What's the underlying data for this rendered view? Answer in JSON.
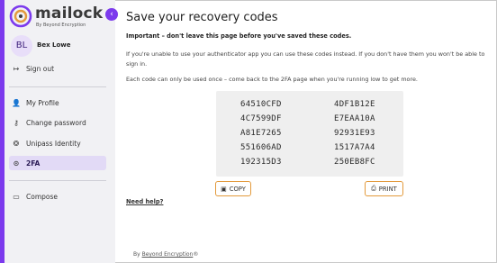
{
  "colors": {
    "accent": "#7c3aed",
    "button_border": "#e39a3c",
    "codes_bg": "#efefef",
    "active_nav_bg": "#e2daf6"
  },
  "logo": {
    "word": "mailock",
    "subtitle": "By Beyond Encryption",
    "icon": "mailock-logo-icon"
  },
  "collapse": {
    "icon": "chevron-left-icon",
    "glyph": "‹"
  },
  "user": {
    "initials": "BL",
    "name": "Bex Lowe"
  },
  "sidebar": {
    "sign_out": {
      "label": "Sign out",
      "icon": "sign-out-icon",
      "glyph": "↦"
    },
    "items": [
      {
        "label": "My Profile",
        "icon": "person-icon",
        "glyph": "👤"
      },
      {
        "label": "Change password",
        "icon": "key-icon",
        "glyph": "⚷"
      },
      {
        "label": "Unipass Identity",
        "icon": "shield-icon",
        "glyph": "❂"
      },
      {
        "label": "2FA",
        "icon": "location-pin-icon",
        "glyph": "⊙",
        "active": true
      }
    ],
    "compose": {
      "label": "Compose",
      "icon": "compose-icon",
      "glyph": "▭"
    }
  },
  "main": {
    "title": "Save your recovery codes",
    "important": "Important – don't leave this page before you've saved these codes.",
    "para1": "If you're unable to use your authenticator app you can use these codes instead. If you don't have them you won't be able to sign in.",
    "para2": "Each code can only be used once – come back to the 2FA page when you're running low to get more.",
    "codes": [
      [
        "64510CFD",
        "4DF1B12E"
      ],
      [
        "4C7599DF",
        "E7EAA10A"
      ],
      [
        "A81E7265",
        "92931E93"
      ],
      [
        "551606AD",
        "1517A7A4"
      ],
      [
        "192315D3",
        "250EB8FC"
      ]
    ],
    "copy_button": {
      "label": "COPY",
      "icon": "clipboard-icon",
      "glyph": "▣"
    },
    "print_button": {
      "label": "PRINT",
      "icon": "printer-icon",
      "glyph": "⎙"
    },
    "help_link": "Need help?"
  },
  "footer": {
    "prefix": "By ",
    "brand": "Beyond Encryption",
    "suffix": "®"
  }
}
